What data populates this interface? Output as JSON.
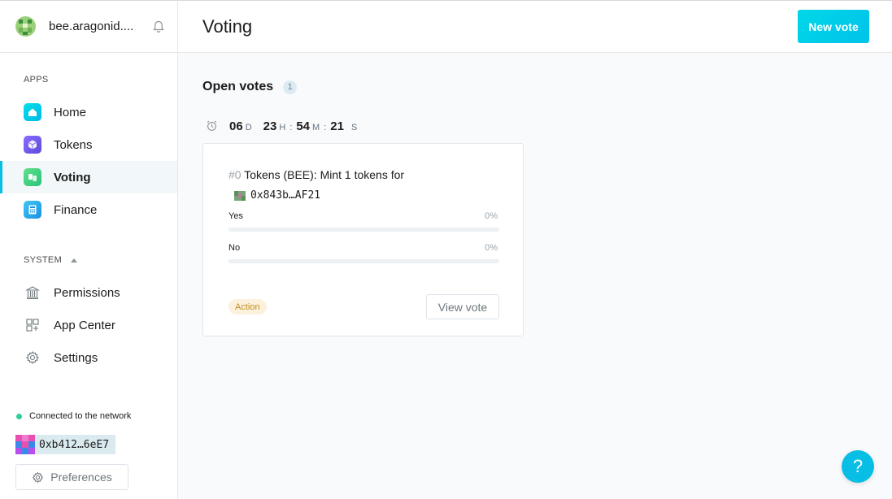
{
  "org": {
    "name": "bee.aragonid....",
    "avatar_icon": "org-pixel-avatar",
    "notifications_icon": "bell-icon"
  },
  "sidebar": {
    "apps_label": "APPS",
    "apps": [
      {
        "label": "Home",
        "icon": "home-app-icon",
        "active": false
      },
      {
        "label": "Tokens",
        "icon": "tokens-app-icon",
        "active": false
      },
      {
        "label": "Voting",
        "icon": "voting-app-icon",
        "active": true
      },
      {
        "label": "Finance",
        "icon": "finance-app-icon",
        "active": false
      }
    ],
    "system_label": "SYSTEM",
    "system": [
      {
        "label": "Permissions",
        "icon": "bank-icon"
      },
      {
        "label": "App Center",
        "icon": "app-center-icon"
      },
      {
        "label": "Settings",
        "icon": "gear-icon"
      }
    ],
    "connection_status": "Connected to the network",
    "account_address": "0xb412…6eE7",
    "preferences_label": "Preferences"
  },
  "header": {
    "title": "Voting",
    "new_vote_label": "New vote"
  },
  "open_votes": {
    "label": "Open votes",
    "count": "1",
    "timer": {
      "days": "06",
      "days_unit": "D",
      "hours": "23",
      "hours_unit": "H",
      "minutes": "54",
      "minutes_unit": "M",
      "seconds": "21",
      "seconds_unit": "S",
      "sep": ":"
    },
    "votes": [
      {
        "number": "#0",
        "description": "Tokens (BEE): Mint 1 tokens for",
        "address": "0x843b…AF21",
        "options": [
          {
            "label": "Yes",
            "percent": "0%",
            "fraction": 0
          },
          {
            "label": "No",
            "percent": "0%",
            "fraction": 0
          }
        ],
        "badge": "Action",
        "view_label": "View vote"
      }
    ]
  },
  "help_label": "?",
  "colors": {
    "accent": "#08bee5",
    "positive": "#2ccf96",
    "badge_bg": "#fcf1dc",
    "badge_text": "#c38d22"
  }
}
